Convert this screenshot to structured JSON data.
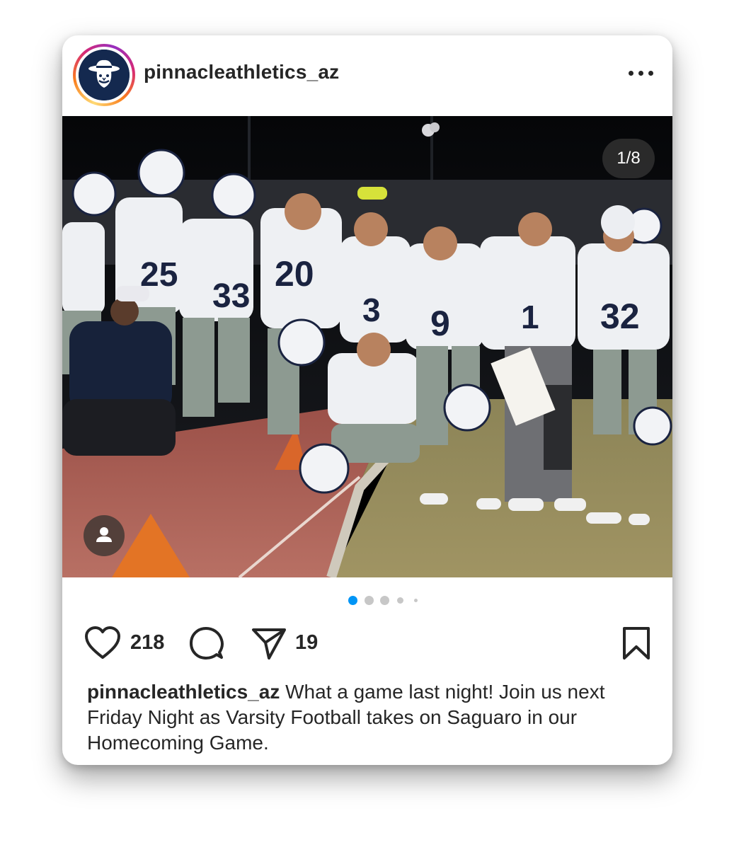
{
  "post": {
    "username": "pinnacleathletics_az",
    "avatar_icon": "pioneer-mascot-logo",
    "more_icon": "more-horizontal-icon"
  },
  "media": {
    "counter": "1/8",
    "current_index": 1,
    "total": 8,
    "tag_icon": "user-tag-icon",
    "photo_alt": "football-team-sideline-photo"
  },
  "actions": {
    "likes": "218",
    "shares": "19",
    "like_icon": "heart-icon",
    "comment_icon": "comment-icon",
    "share_icon": "send-icon",
    "save_icon": "bookmark-icon"
  },
  "caption": {
    "username": "pinnacleathletics_az",
    "text": " What a game last night! Join us next Friday Night as Varsity Football takes on Saguaro in our Homecoming Game."
  },
  "colors": {
    "text": "#262626",
    "dot_active": "#0095f6",
    "dot_inactive": "#c7c7c7",
    "navy": "#14294f"
  }
}
